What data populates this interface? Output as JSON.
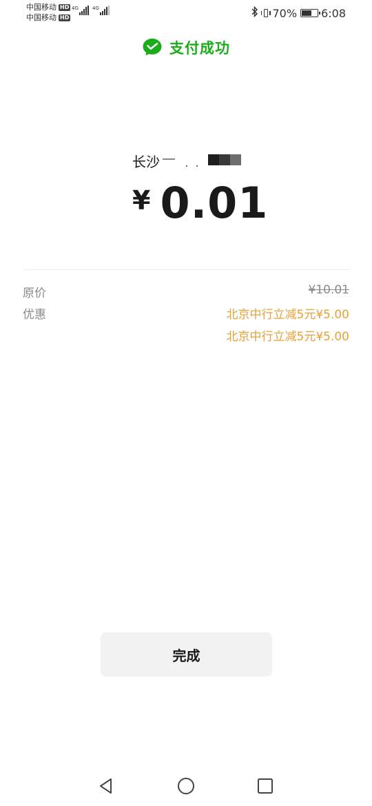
{
  "status_bar": {
    "carrier_1": "中国移动",
    "carrier_2": "中国移动",
    "hd_badge": "HD",
    "network_1": "4G",
    "network_2": "4G",
    "battery_percent": "70%",
    "time": "6:08",
    "battery_level": 0.7,
    "icons": [
      "bluetooth-icon",
      "vibrate-icon",
      "battery-icon"
    ]
  },
  "header": {
    "icon": "wechat-pay-icon",
    "title": "支付成功",
    "accent_color": "#1aad19"
  },
  "payment": {
    "merchant_visible": "长沙",
    "currency_symbol": "¥",
    "amount": "0.01"
  },
  "details": {
    "original_label": "原价",
    "original_value": "¥10.01",
    "discount_label": "优惠",
    "discounts": [
      "北京中行立减5元¥5.00",
      "北京中行立减5元¥5.00"
    ],
    "discount_color": "#e8a034"
  },
  "actions": {
    "done_label": "完成"
  },
  "nav_bar": {
    "icons": [
      "back-triangle-icon",
      "home-circle-icon",
      "recents-square-icon"
    ]
  }
}
